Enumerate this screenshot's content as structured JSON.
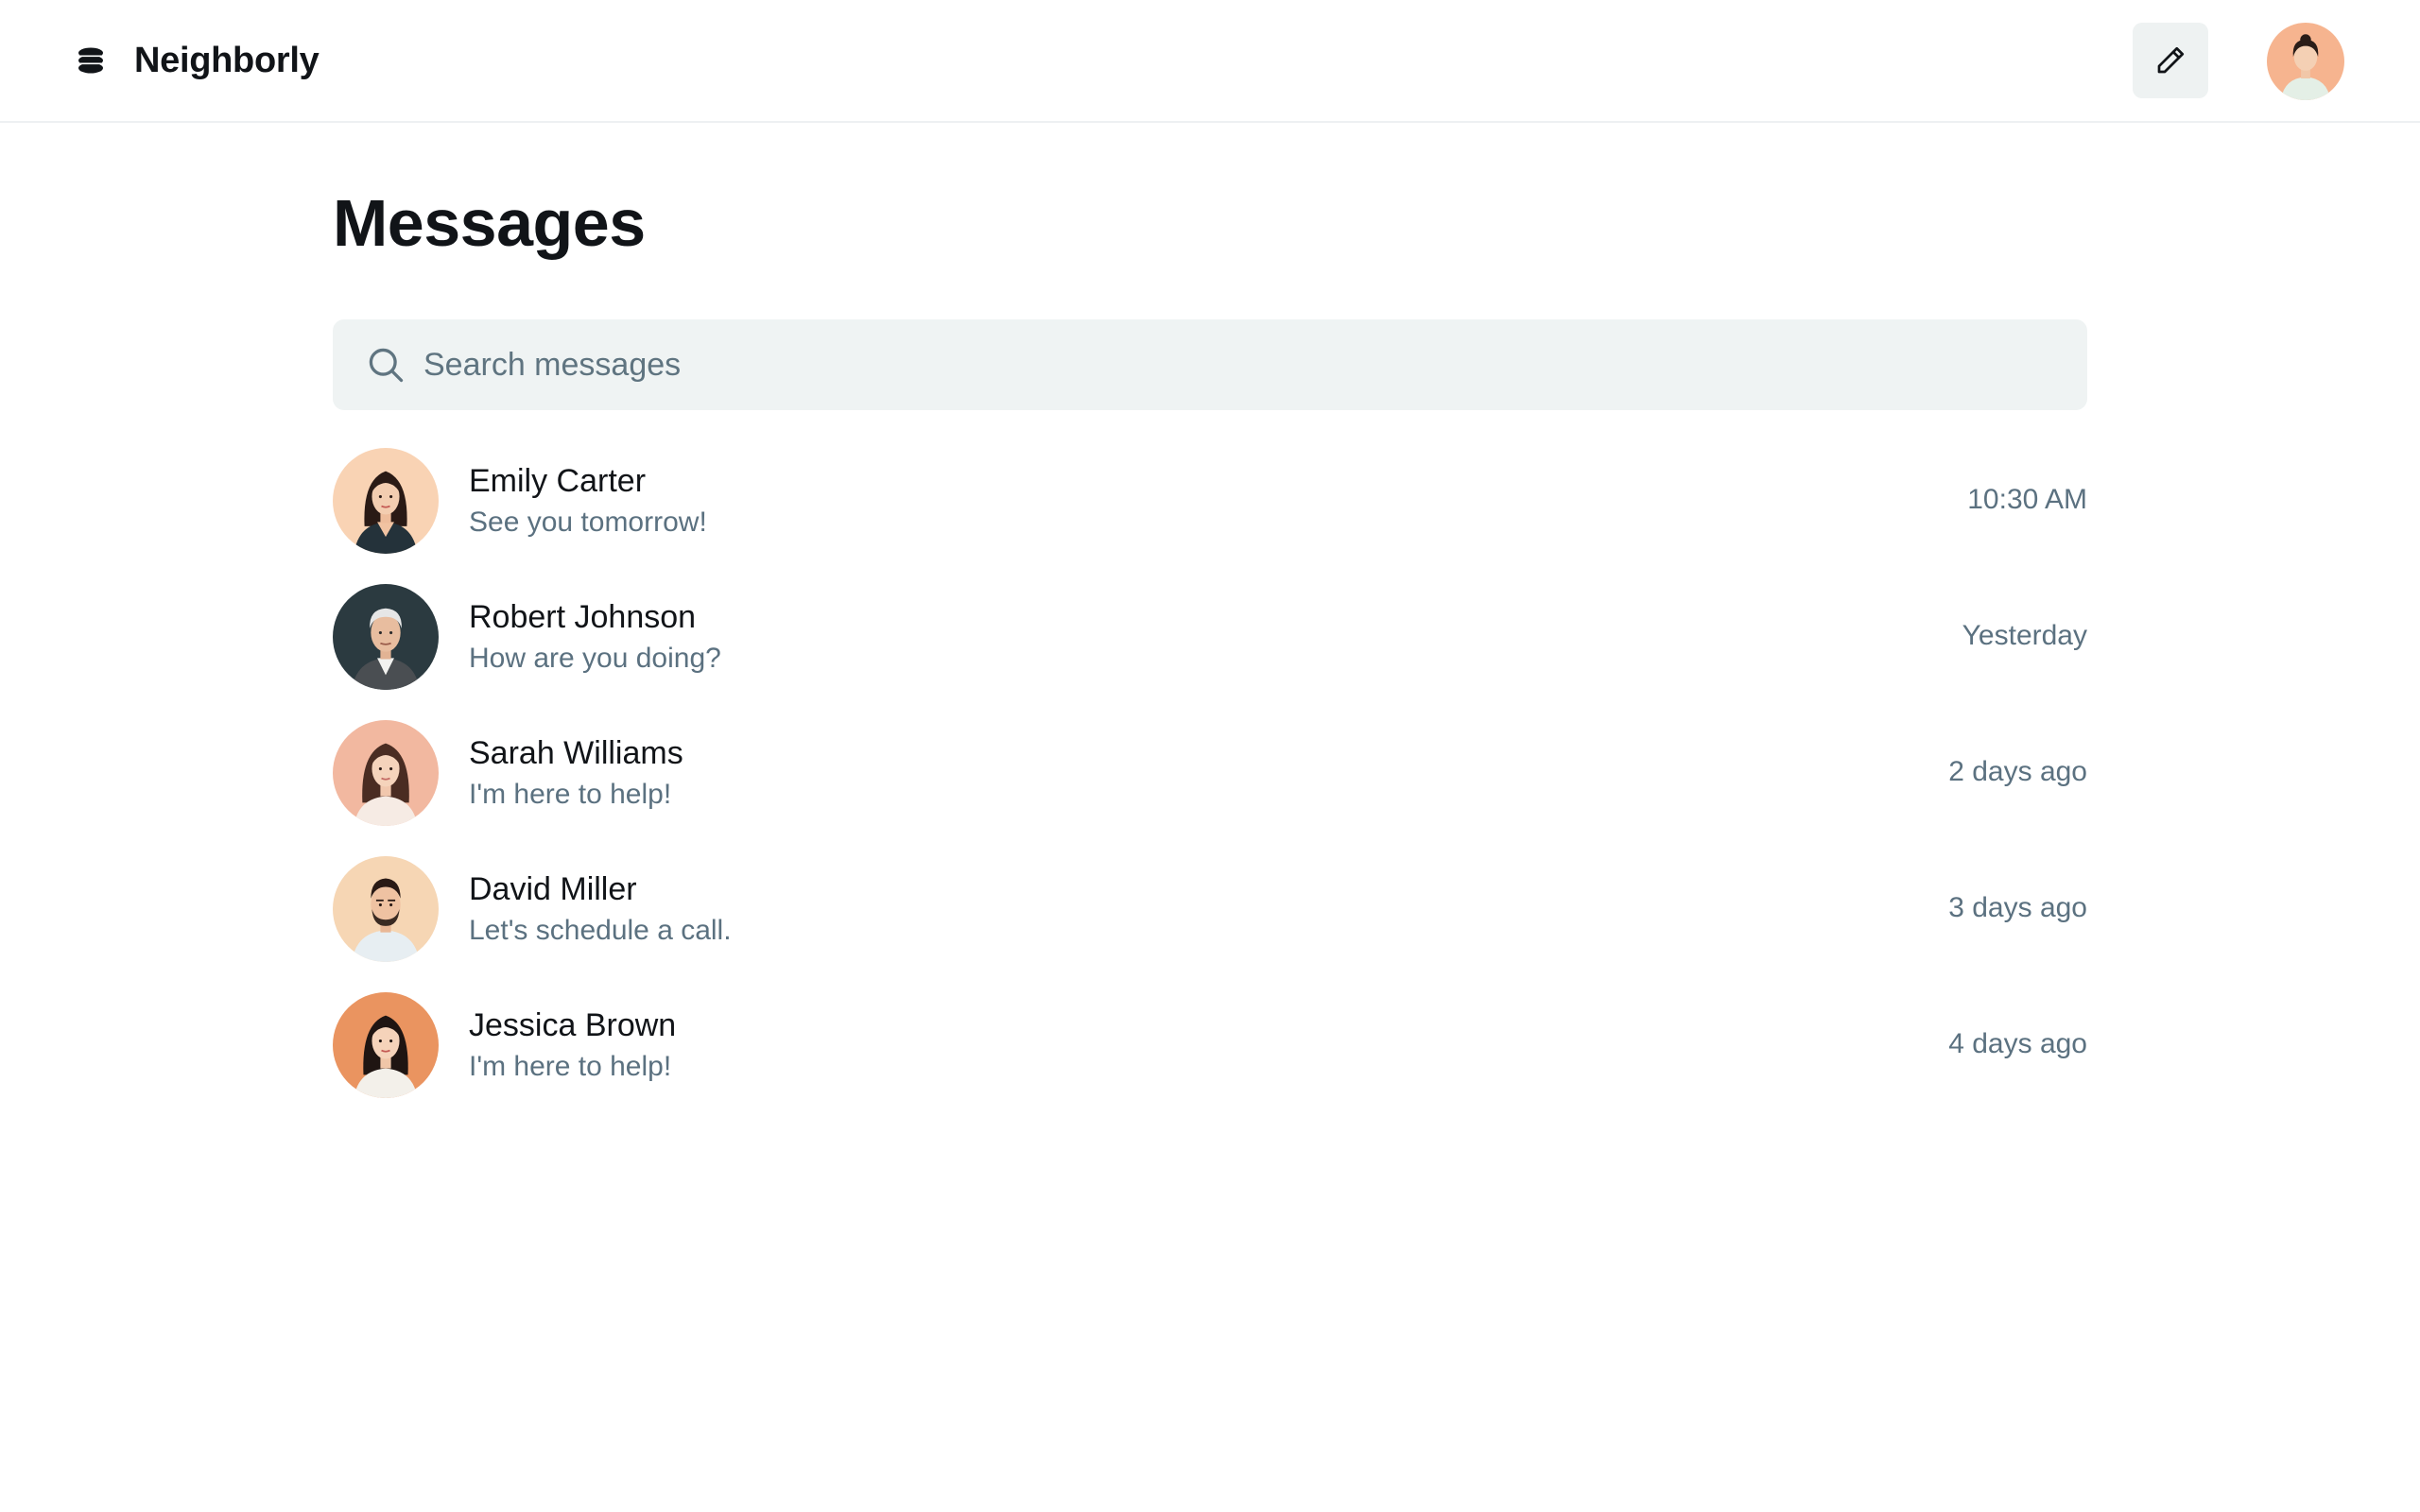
{
  "app": {
    "brand_name": "Neighborly",
    "logo_icon": "stack-logo-icon",
    "compose_icon": "pencil-icon"
  },
  "page": {
    "title": "Messages"
  },
  "search": {
    "placeholder": "Search messages",
    "value": "",
    "icon": "search-icon"
  },
  "conversations": [
    {
      "name": "Emily Carter",
      "preview": "See you tomorrow!",
      "time": "10:30 AM",
      "avatar_bg": "#f9d3b4"
    },
    {
      "name": "Robert Johnson",
      "preview": "How are you doing?",
      "time": "Yesterday",
      "avatar_bg": "#2b3a40"
    },
    {
      "name": "Sarah Williams",
      "preview": "I'm here to help!",
      "time": "2 days ago",
      "avatar_bg": "#f2b8a0"
    },
    {
      "name": "David Miller",
      "preview": "Let's schedule a call.",
      "time": "3 days ago",
      "avatar_bg": "#f6d6b4"
    },
    {
      "name": "Jessica Brown",
      "preview": "I'm here to help!",
      "time": "4 days ago",
      "avatar_bg": "#ea9460"
    }
  ],
  "colors": {
    "text_primary": "#111418",
    "text_secondary": "#5b7180",
    "search_bg": "#eff3f3",
    "header_border": "#eef0f2"
  }
}
